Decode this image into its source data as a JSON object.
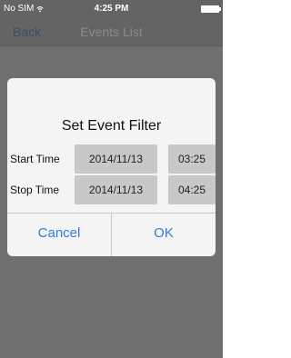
{
  "status_bar": {
    "carrier": "No SIM",
    "time": "4:25 PM",
    "icons": [
      "wifi-icon",
      "battery-icon"
    ]
  },
  "nav": {
    "back_label": "Back",
    "title": "Events List"
  },
  "dialog": {
    "title": "Set Event Filter",
    "start": {
      "label": "Start Time",
      "date": "2014/11/13",
      "time": "03:25"
    },
    "stop": {
      "label": "Stop Time",
      "date": "2014/11/13",
      "time": "04:25"
    },
    "cancel_label": "Cancel",
    "ok_label": "OK"
  },
  "colors": {
    "dim_background": "#6f6f6f",
    "dialog_background": "#f4f4f4",
    "field_background": "#c8c8c8",
    "accent": "#2f7de0"
  }
}
